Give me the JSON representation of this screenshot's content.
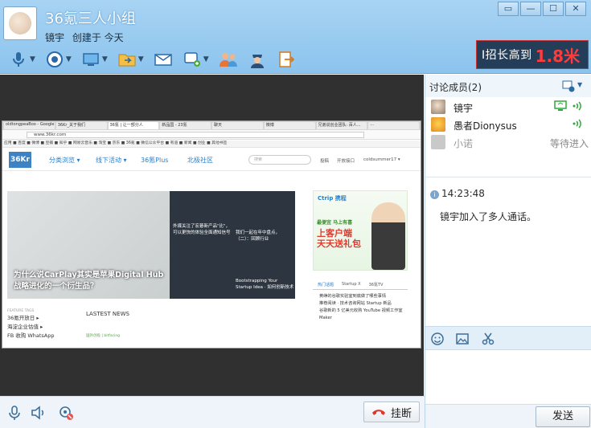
{
  "window": {
    "group_name": "36氪三人小组",
    "creator": "镜宇",
    "created": "创建于 今天",
    "controls": [
      "▭",
      "—",
      "☐",
      "✕"
    ]
  },
  "toolbar": {
    "icons": [
      "microphone-icon",
      "camera-icon",
      "screen-share-icon",
      "folder-icon",
      "mail-icon",
      "app-icon",
      "members-icon",
      "police-icon",
      "exit-icon"
    ]
  },
  "promo": {
    "text1": "I招长高到",
    "text2": "1.8米"
  },
  "shared_screen": {
    "tabs": [
      "oldtongpeaBoo - Google",
      "36Kr_关于我们",
      "36氪 | 让一部分人",
      "新品国 - 23氪",
      "聊天",
      "微博",
      "兄弟说创业团队: 百人...",
      "..."
    ],
    "url": "www.36kr.com",
    "bookmarks": "应用  ■ 百度  ■ 微博  ■ 豆瓣  ■ 知乎  ■ 网易云音乐  ■ 淘宝  ■ 京东  ■ 36氪  ■ 微信公众平台  ■ 有道  ■ 新闻  ■ 创业  ■ 其他书签",
    "logo": "36Kr",
    "nav": [
      "分类浏览 ▾",
      "线下活动 ▾",
      "36氪Plus",
      "北极社区"
    ],
    "search_placeholder": "搜索",
    "nav_right": [
      "投稿",
      "开放接口",
      "coldsummer17 ▾"
    ],
    "hero_caption": "为什么说CarPlay其实是苹果Digital Hub\n战略进化的一个衍生品？",
    "hero_side_caption1": "外媒关注了宏碁新产品\"比\"，\n可以更快的体验全面通知信号",
    "hero_side_caption2": "我们一起在年中盘点，\n（二）：回顾行业",
    "hero_side_caption3": "Bootstrapping Your\nStartup Idea · 如何创新技术",
    "ad_brand": "Ctrip 携程",
    "ad_line1": "最便宜 马上有喜",
    "ad_line2": "上客户端\n天天送礼包",
    "side_tabs": [
      "热门话题",
      "Startup X",
      "36氪TV"
    ],
    "side_list": [
      "黄峥的谷歌实验室到底做了哪些事情",
      "推荐阅读 · 技术咨询网站 Startup 新品",
      "谷歌新的 5 亿美元收购 YouTube 视频工作室 Maker"
    ],
    "featured_tag": "FEATURE TAGS",
    "featured": [
      "36氪开放日 ▸",
      "海淀企业估值 ▸",
      "FB 收购 WhatsApp"
    ],
    "last_news": "LASTEST NEWS",
    "news_line": "国外创投  |  bitfacing"
  },
  "members_panel": {
    "title": "讨论成员(2)",
    "members": [
      {
        "name": "镜宇",
        "status": ""
      },
      {
        "name": "愚者Dionysus",
        "status": ""
      },
      {
        "name": "小诺",
        "status": "等待进入"
      }
    ]
  },
  "chat": {
    "time": "14:23:48",
    "message": "镜宇加入了多人通话。",
    "send_label": "发送"
  },
  "call": {
    "hangup_label": "挂断"
  }
}
